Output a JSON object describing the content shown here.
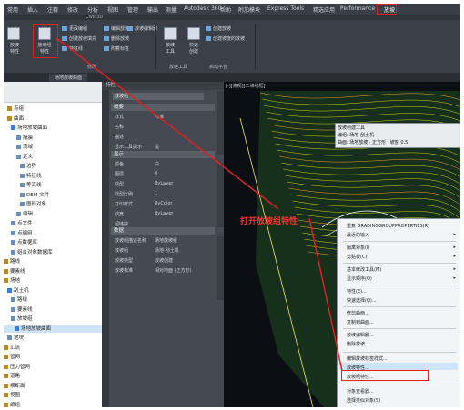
{
  "app": {
    "title": "Civil 3D",
    "menubar": [
      "常用",
      "插入",
      "注释",
      "修改",
      "分析",
      "视图",
      "管理",
      "输出",
      "测量",
      "Autodesk 360",
      "帮助",
      "附加模块",
      "Express Tools",
      "精选应用",
      "Performance",
      "放坡"
    ]
  },
  "ribbon": {
    "buttons": [
      {
        "label": "放坡\n特性"
      },
      {
        "label": "放坡组\n特性"
      }
    ],
    "small": [
      "更改编组",
      "创建放坡填充",
      "特征线",
      "编辑放坡",
      "删除放坡",
      "附着标签",
      "放坡编辑器",
      "放坡\n工具",
      "快速\n创建",
      "创建放坡",
      "创建坡度的放坡"
    ],
    "groups": [
      "修改",
      "放坡工具",
      "启动平台"
    ]
  },
  "doc_tab": "场地放坡曲面",
  "tree": {
    "items": [
      "点组",
      "曲面",
      "场地放坡曲面",
      "掩膜",
      "流域",
      "定义",
      "边界",
      "特征线",
      "等高线",
      "DEM 文件",
      "图形对象",
      "编辑",
      "点文件",
      "点编组",
      "点数据库",
      "组合对象数据库",
      "路线",
      "要素线",
      "场地",
      "刮土机",
      "路线",
      "要素线",
      "放坡组",
      "场地放坡曲面",
      "地块",
      "汇流",
      "管网",
      "压力管网",
      "道路",
      "横断面",
      "视图",
      "编组"
    ]
  },
  "props": {
    "header": "特性",
    "object": "放坡组",
    "sections": {
      "general": "概要",
      "display": "显示",
      "data": "数据"
    },
    "general_rows": [
      [
        "样式",
        "标准"
      ],
      [
        "名称",
        ""
      ],
      [
        "描述",
        ""
      ],
      [
        "显示工具提示",
        "是"
      ]
    ],
    "display_rows": [
      [
        "颜色",
        "白"
      ],
      [
        "图层",
        "0"
      ],
      [
        "线型",
        "ByLayer"
      ],
      [
        "线型比例",
        "1"
      ],
      [
        "打印样式",
        "ByColor"
      ],
      [
        "线宽",
        "ByLayer"
      ],
      [
        "超链接",
        ""
      ]
    ],
    "data_rows": [
      [
        "放坡组描述名称",
        "场地放坡组"
      ],
      [
        "放坡组",
        "场地-刮土机"
      ],
      [
        "放坡类型",
        "放坡创建"
      ],
      [
        "放坡标准",
        "相对地面 (正方形)"
      ]
    ]
  },
  "viewport_label": "[-][俯视][二维线框]",
  "grading_tools": {
    "title": "放坡创建工具",
    "row1": "编组: 场地-刮土机",
    "row2": "曲面: 场地放坡 · 正方形 · 坡度 0.5"
  },
  "context_menu": {
    "items": [
      "重复 GRADINGGROUPPROPERTIES(R)",
      "最近的输入",
      "隔离对象(I)",
      "剪贴板(C)",
      "基本修改工具(M)",
      "显示顺序(O)",
      "特性(E)...",
      "快速选择(Q)...",
      "修剪曲面...",
      "复制到曲面...",
      "放坡编辑器...",
      "删除放坡...",
      "编辑放坡标签样式...",
      "放坡特性...",
      "放坡组特性...",
      "对象查看器...",
      "选择类似对象(S)"
    ],
    "submenu_flags": [
      false,
      true,
      true,
      true,
      true,
      true,
      false,
      false,
      false,
      false,
      false,
      false,
      false,
      false,
      false,
      false,
      false
    ]
  },
  "annotation": "打开放坡组特性",
  "colors": {
    "accent_red": "#e02020",
    "terrain": "#d6d018"
  }
}
